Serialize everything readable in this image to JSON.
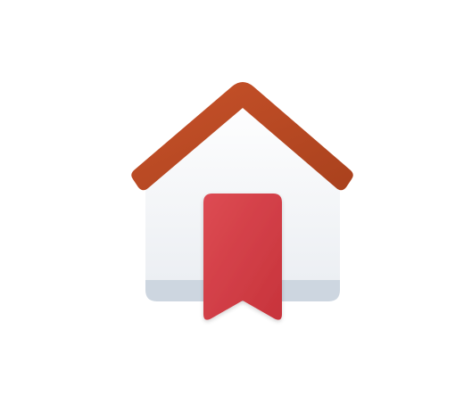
{
  "icon": {
    "name": "home-bookmark-icon",
    "colors": {
      "background": "#ffffff",
      "house_body_top": "#ffffff",
      "house_body_bottom": "#eceff3",
      "house_base": "#cdd6e0",
      "roof_light": "#c8522a",
      "roof_dark": "#a9411d",
      "bookmark_light": "#dd4b53",
      "bookmark_dark": "#c7333b"
    }
  }
}
